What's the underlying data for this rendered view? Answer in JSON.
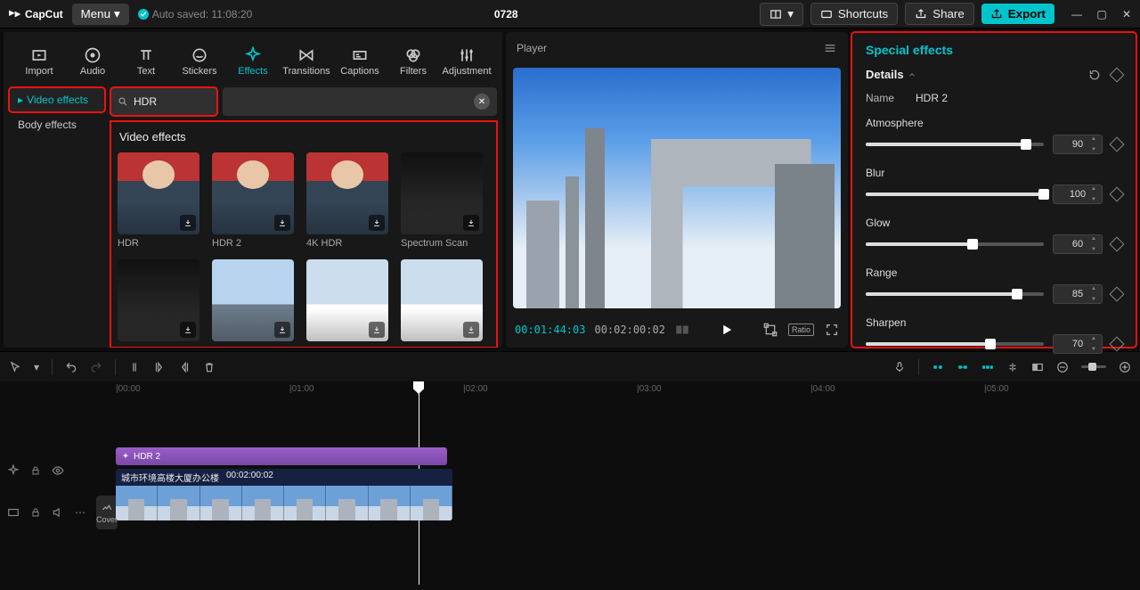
{
  "titlebar": {
    "brand": "CapCut",
    "menu_label": "Menu",
    "autosave": "Auto saved: 11:08:20",
    "project_name": "0728",
    "shortcuts_label": "Shortcuts",
    "share_label": "Share",
    "export_label": "Export"
  },
  "tabs": {
    "items": [
      {
        "label": "Import"
      },
      {
        "label": "Audio"
      },
      {
        "label": "Text"
      },
      {
        "label": "Stickers"
      },
      {
        "label": "Effects"
      },
      {
        "label": "Transitions"
      },
      {
        "label": "Captions"
      },
      {
        "label": "Filters"
      },
      {
        "label": "Adjustment"
      }
    ]
  },
  "sidebar": {
    "video_effects": "Video effects",
    "body_effects": "Body effects"
  },
  "search": {
    "placeholder": "",
    "value": "HDR"
  },
  "effects_section": {
    "title": "Video effects",
    "items": [
      {
        "label": "HDR",
        "kind": "person"
      },
      {
        "label": "HDR 2",
        "kind": "person"
      },
      {
        "label": "4K HDR",
        "kind": "person"
      },
      {
        "label": "Spectrum Scan",
        "kind": "dark"
      },
      {
        "label": "",
        "kind": "dark"
      },
      {
        "label": "",
        "kind": "city"
      },
      {
        "label": "",
        "kind": "snow"
      },
      {
        "label": "",
        "kind": "snow"
      }
    ]
  },
  "player": {
    "title": "Player",
    "current_time": "00:01:44:03",
    "total_time": "00:02:00:02",
    "ratio_label": "Ratio"
  },
  "props": {
    "panel_title": "Special effects",
    "details_label": "Details",
    "name_label": "Name",
    "name_value": "HDR 2",
    "params": [
      {
        "label": "Atmosphere",
        "value": 90
      },
      {
        "label": "Blur",
        "value": 100
      },
      {
        "label": "Glow",
        "value": 60
      },
      {
        "label": "Range",
        "value": 85
      },
      {
        "label": "Sharpen",
        "value": 70
      }
    ]
  },
  "ruler": {
    "marks": [
      "00:00",
      "01:00",
      "02:00",
      "03:00",
      "04:00",
      "05:00"
    ]
  },
  "timeline": {
    "effect_clip_label": "HDR 2",
    "video_clip_title": "城市环境高楼大厦办公楼",
    "video_clip_time": "00:02:00:02",
    "cover_label": "Cover"
  }
}
